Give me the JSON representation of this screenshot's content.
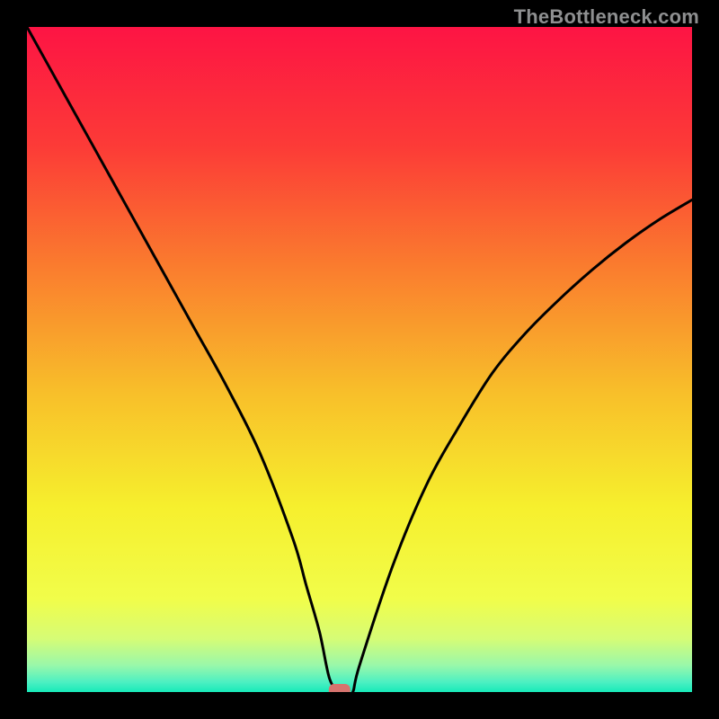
{
  "watermark": "TheBottleneck.com",
  "chart_data": {
    "type": "line",
    "title": "",
    "xlabel": "",
    "ylabel": "",
    "xlim": [
      0,
      100
    ],
    "ylim": [
      0,
      100
    ],
    "grid": false,
    "legend": false,
    "series": [
      {
        "name": "bottleneck-curve",
        "x": [
          0,
          5,
          10,
          15,
          20,
          25,
          30,
          35,
          40,
          42,
          44,
          45.5,
          47,
          48,
          49,
          50,
          55,
          60,
          65,
          70,
          75,
          80,
          85,
          90,
          95,
          100
        ],
        "y": [
          100,
          91,
          82,
          73,
          64,
          55,
          46,
          36,
          23,
          16,
          9,
          2,
          0,
          0,
          0,
          4,
          19,
          31,
          40,
          48,
          54,
          59,
          63.5,
          67.5,
          71,
          74
        ]
      }
    ],
    "marker": {
      "name": "optimal-point",
      "x": 47,
      "y": 0,
      "color": "#d6736e"
    },
    "background_gradient": {
      "stops": [
        {
          "pos": 0.0,
          "color": "#fd1444"
        },
        {
          "pos": 0.18,
          "color": "#fc3b37"
        },
        {
          "pos": 0.36,
          "color": "#fa7c2e"
        },
        {
          "pos": 0.55,
          "color": "#f8bf2a"
        },
        {
          "pos": 0.72,
          "color": "#f6ef2d"
        },
        {
          "pos": 0.86,
          "color": "#f1fd4a"
        },
        {
          "pos": 0.92,
          "color": "#d6fc76"
        },
        {
          "pos": 0.96,
          "color": "#99f8aa"
        },
        {
          "pos": 0.985,
          "color": "#4df0c2"
        },
        {
          "pos": 1.0,
          "color": "#17eab9"
        }
      ]
    }
  }
}
